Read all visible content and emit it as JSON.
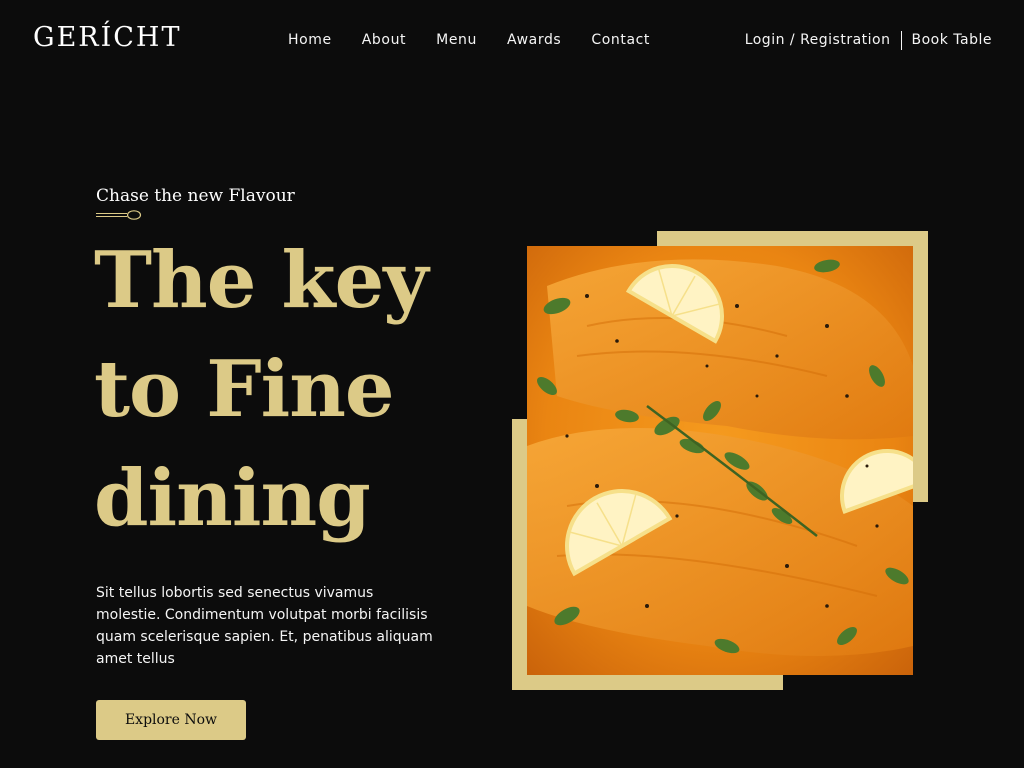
{
  "brand": {
    "logo": "GERÍCHT"
  },
  "nav": {
    "links": [
      "Home",
      "About",
      "Menu",
      "Awards",
      "Contact"
    ],
    "login_label": "Login / Registration",
    "book_label": "Book Table"
  },
  "hero": {
    "subtitle": "Chase the new Flavour",
    "title_lines": [
      "The key",
      "to Fine",
      "dining"
    ],
    "description": "Sit tellus lobortis sed senectus vivamus molestie. Condimentum volutpat morbi facilisis quam scelerisque sapien. Et, penatibus aliquam amet tellus",
    "button_label": "Explore Now"
  },
  "icons": {
    "spoon": "spoon-icon"
  },
  "colors": {
    "background": "#0c0c0c",
    "accent_gold": "#dcca87",
    "text_white": "#f5f5f5"
  }
}
